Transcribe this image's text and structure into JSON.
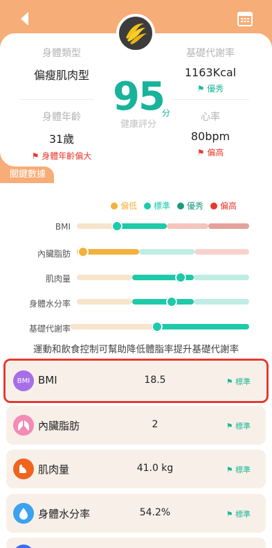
{
  "colors": {
    "accent": "#f7ad78",
    "low": "#f2b13d",
    "standard": "#1ecaaa",
    "excellent": "#1e9a7e",
    "high": "#e8372c"
  },
  "header": {
    "avatar_icon": "banana-icon",
    "body_type_label": "身體類型",
    "body_type_value": "偏瘦肌肉型",
    "bmr_label": "基礎代謝率",
    "bmr_value": "1163Kcal",
    "bmr_note": "優秀",
    "age_label": "身體年齡",
    "age_value": "31歲",
    "age_note": "身體年齡偏大",
    "hr_label": "心率",
    "hr_value": "80bpm",
    "hr_note": "偏高",
    "score_value": "95",
    "score_unit": "分",
    "score_caption": "健康評分"
  },
  "section_title": "關鍵數據",
  "legend": [
    "偏低",
    "標準",
    "優秀",
    "偏高"
  ],
  "chart_data": {
    "type": "range-bars",
    "legend": [
      "偏低",
      "標準",
      "優秀",
      "偏高"
    ],
    "rows": [
      {
        "label": "BMI",
        "value_marker_fraction": 0.23
      },
      {
        "label": "內臟脂肪",
        "value_marker_fraction": 0.03
      },
      {
        "label": "肌肉量",
        "value_marker_fraction": 0.6
      },
      {
        "label": "身體水分率",
        "value_marker_fraction": 0.55
      },
      {
        "label": "基礎代謝率",
        "value_marker_fraction": 0.49
      }
    ]
  },
  "advice": "運動和飲食控制可幫助降低體脂率提升基礎代謝率",
  "metrics": [
    {
      "name": "BMI",
      "icon_text": "BMI",
      "value": "18.5",
      "status": "標準"
    },
    {
      "name": "內臟脂肪",
      "value": "2",
      "status": "標準"
    },
    {
      "name": "肌肉量",
      "value": "41.0 kg",
      "status": "標準"
    },
    {
      "name": "身體水分率",
      "value": "54.2%",
      "status": "標準"
    }
  ]
}
